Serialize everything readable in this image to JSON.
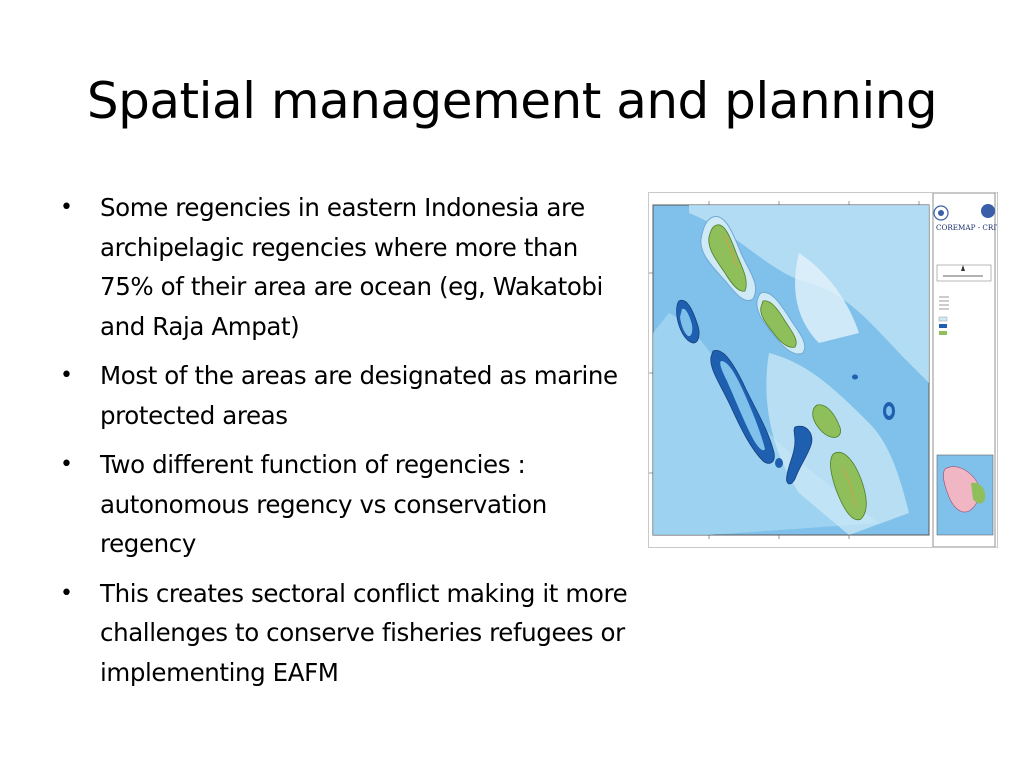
{
  "slide": {
    "title": "Spatial management and planning",
    "bullets": [
      {
        "text": "Some regencies in eastern Indonesia are archipelagic regencies where more than 75% of their area are ocean (eg, Wakatobi and Raja Ampat)"
      },
      {
        "text": "Most of the areas are designated as marine protected areas"
      },
      {
        "text": "Two different function of regencies : autonomous regency vs conservation regency"
      },
      {
        "text": "This creates sectoral conflict making it more challenges to conserve fisheries refugees or implementing EAFM"
      }
    ],
    "bullet_glyph": "•"
  },
  "map": {
    "legend_title": "COREMAP - CRITC",
    "colors": {
      "deep_sea": "#6fb7e6",
      "shallow_sea": "#cfe9f7",
      "reef": "#1f5fb0",
      "land": "#8fbf5a",
      "land_dark": "#5f8f3a"
    }
  }
}
